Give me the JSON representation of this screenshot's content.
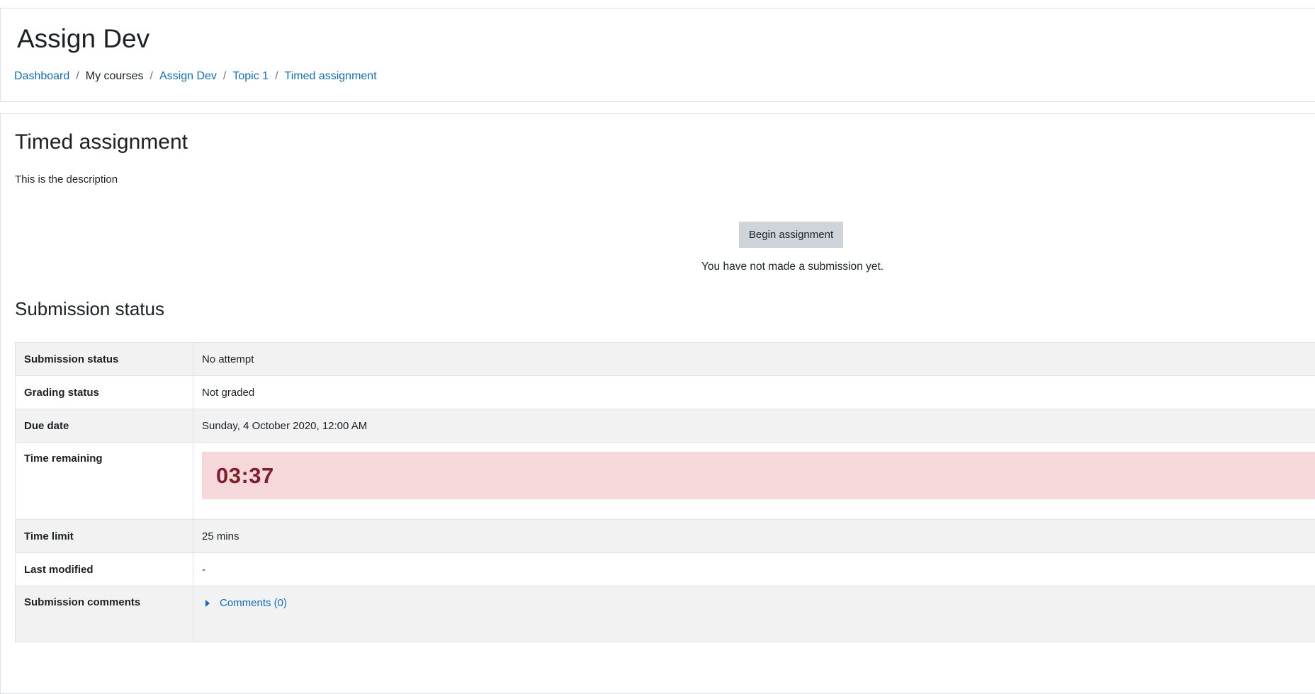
{
  "course": {
    "title": "Assign Dev"
  },
  "breadcrumb": {
    "dashboard": "Dashboard",
    "my_courses": "My courses",
    "course": "Assign Dev",
    "topic": "Topic 1",
    "activity": "Timed assignment",
    "separator": "/"
  },
  "activity": {
    "title": "Timed assignment",
    "description": "This is the description",
    "begin_button": "Begin assignment",
    "no_submission": "You have not made a submission yet."
  },
  "submission": {
    "section_title": "Submission status",
    "rows": [
      {
        "label": "Submission status",
        "value": "No attempt"
      },
      {
        "label": "Grading status",
        "value": "Not graded"
      },
      {
        "label": "Due date",
        "value": "Sunday, 4 October 2020, 12:00 AM"
      },
      {
        "label": "Time remaining",
        "value": "03:37"
      },
      {
        "label": "Time limit",
        "value": "25 mins"
      },
      {
        "label": "Last modified",
        "value": "-"
      },
      {
        "label": "Submission comments",
        "value": "Comments (0)"
      }
    ]
  },
  "colors": {
    "link": "#0f6cbf",
    "timer_bg": "#f6d8db",
    "timer_text": "#7d2029",
    "button_bg": "#ced4da"
  }
}
